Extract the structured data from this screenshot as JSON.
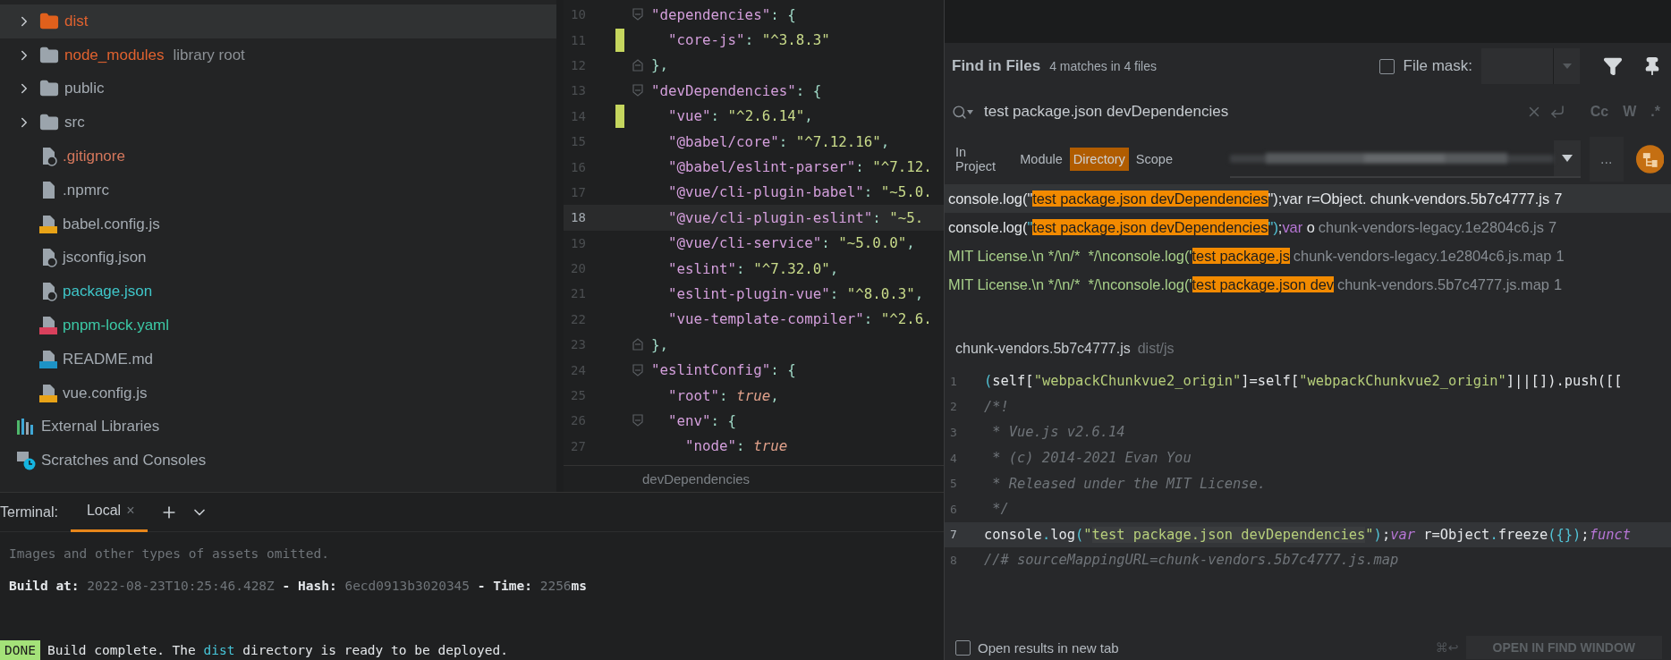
{
  "project_tree": {
    "items": [
      {
        "kind": "folder-excluded",
        "name": "dist",
        "color": "#e0622f",
        "expanded": false,
        "selected": true
      },
      {
        "kind": "folder",
        "name": "node_modules",
        "note": "library root",
        "color": "#e0622f",
        "expanded": false,
        "selected": false
      },
      {
        "kind": "folder",
        "name": "public",
        "color": "#a4abb2",
        "expanded": false,
        "selected": false
      },
      {
        "kind": "folder",
        "name": "src",
        "color": "#a4abb2",
        "expanded": false,
        "selected": false
      },
      {
        "kind": "ignore",
        "name": ".gitignore",
        "color": "#d4775c",
        "selected": false
      },
      {
        "kind": "text",
        "name": ".npmrc",
        "color": "#a4abb2",
        "selected": false
      },
      {
        "kind": "js",
        "name": "babel.config.js",
        "color": "#a4abb2",
        "selected": false
      },
      {
        "kind": "json",
        "name": "jsconfig.json",
        "color": "#a4abb2",
        "selected": false
      },
      {
        "kind": "json",
        "name": "package.json",
        "color": "#3fc6c9",
        "selected": false
      },
      {
        "kind": "yaml",
        "name": "pnpm-lock.yaml",
        "color": "#3cc9a6",
        "selected": false
      },
      {
        "kind": "md",
        "name": "README.md",
        "color": "#a4abb2",
        "selected": false
      },
      {
        "kind": "js",
        "name": "vue.config.js",
        "color": "#a4abb2",
        "selected": false
      },
      {
        "kind": "libraries",
        "name": "External Libraries",
        "color": "#a4abb2",
        "selected": false
      },
      {
        "kind": "scratches",
        "name": "Scratches and Consoles",
        "color": "#a4abb2",
        "selected": false
      }
    ]
  },
  "editor": {
    "lines": [
      {
        "number": "10",
        "kind": "fold-start",
        "changed": false,
        "current": false,
        "tokens": [
          {
            "kind": "key",
            "text": "\"dependencies\""
          },
          {
            "kind": "punct",
            "text": ": {"
          }
        ]
      },
      {
        "number": "11",
        "changed": true,
        "current": false,
        "tokens": [
          {
            "kind": "key",
            "text": "  \"core-js\""
          },
          {
            "kind": "punct",
            "text": ": "
          },
          {
            "kind": "str",
            "text": "\"^3.8.3\""
          }
        ]
      },
      {
        "number": "12",
        "kind": "fold-end",
        "changed": false,
        "current": false,
        "tokens": [
          {
            "kind": "punct",
            "text": "},"
          }
        ]
      },
      {
        "number": "13",
        "kind": "fold-start",
        "changed": false,
        "current": false,
        "tokens": [
          {
            "kind": "key",
            "text": "\"devDependencies\""
          },
          {
            "kind": "punct",
            "text": ": {"
          }
        ]
      },
      {
        "number": "14",
        "changed": true,
        "current": false,
        "tokens": [
          {
            "kind": "key",
            "text": "  \"vue\""
          },
          {
            "kind": "punct",
            "text": ": "
          },
          {
            "kind": "str",
            "text": "\"^2.6.14\""
          },
          {
            "kind": "punct",
            "text": ","
          }
        ]
      },
      {
        "number": "15",
        "changed": false,
        "current": false,
        "tokens": [
          {
            "kind": "key",
            "text": "  \"@babel/core\""
          },
          {
            "kind": "punct",
            "text": ": "
          },
          {
            "kind": "str",
            "text": "\"^7.12.16\""
          },
          {
            "kind": "punct",
            "text": ","
          }
        ]
      },
      {
        "number": "16",
        "changed": false,
        "current": false,
        "tokens": [
          {
            "kind": "key",
            "text": "  \"@babel/eslint-parser\""
          },
          {
            "kind": "punct",
            "text": ": "
          },
          {
            "kind": "str",
            "text": "\"^7.12."
          }
        ]
      },
      {
        "number": "17",
        "changed": false,
        "current": false,
        "tokens": [
          {
            "kind": "key",
            "text": "  \"@vue/cli-plugin-babel\""
          },
          {
            "kind": "punct",
            "text": ": "
          },
          {
            "kind": "str",
            "text": "\"~5.0."
          }
        ]
      },
      {
        "number": "18",
        "changed": false,
        "current": true,
        "tokens": [
          {
            "kind": "key",
            "text": "  \"@vue/cli-plugin-eslint\""
          },
          {
            "kind": "punct",
            "text": ": "
          },
          {
            "kind": "str",
            "text": "\"~5."
          }
        ]
      },
      {
        "number": "19",
        "changed": false,
        "current": false,
        "tokens": [
          {
            "kind": "key",
            "text": "  \"@vue/cli-service\""
          },
          {
            "kind": "punct",
            "text": ": "
          },
          {
            "kind": "str",
            "text": "\"~5.0.0\""
          },
          {
            "kind": "punct",
            "text": ","
          }
        ]
      },
      {
        "number": "20",
        "changed": false,
        "current": false,
        "tokens": [
          {
            "kind": "key",
            "text": "  \"eslint\""
          },
          {
            "kind": "punct",
            "text": ": "
          },
          {
            "kind": "str",
            "text": "\"^7.32.0\""
          },
          {
            "kind": "punct",
            "text": ","
          }
        ]
      },
      {
        "number": "21",
        "changed": false,
        "current": false,
        "tokens": [
          {
            "kind": "key",
            "text": "  \"eslint-plugin-vue\""
          },
          {
            "kind": "punct",
            "text": ": "
          },
          {
            "kind": "str",
            "text": "\"^8.0.3\""
          },
          {
            "kind": "punct",
            "text": ","
          }
        ]
      },
      {
        "number": "22",
        "changed": false,
        "current": false,
        "tokens": [
          {
            "kind": "key",
            "text": "  \"vue-template-compiler\""
          },
          {
            "kind": "punct",
            "text": ": "
          },
          {
            "kind": "str",
            "text": "\"^2.6."
          }
        ]
      },
      {
        "number": "23",
        "kind": "fold-end",
        "changed": false,
        "current": false,
        "tokens": [
          {
            "kind": "punct",
            "text": "},"
          }
        ]
      },
      {
        "number": "24",
        "kind": "fold-start",
        "changed": false,
        "current": false,
        "tokens": [
          {
            "kind": "key",
            "text": "\"eslintConfig\""
          },
          {
            "kind": "punct",
            "text": ": {"
          }
        ]
      },
      {
        "number": "25",
        "changed": false,
        "current": false,
        "tokens": [
          {
            "kind": "key",
            "text": "  \"root\""
          },
          {
            "kind": "punct",
            "text": ": "
          },
          {
            "kind": "bool",
            "text": "true"
          },
          {
            "kind": "punct",
            "text": ","
          }
        ]
      },
      {
        "number": "26",
        "kind": "fold-start",
        "changed": false,
        "current": false,
        "tokens": [
          {
            "kind": "key",
            "text": "  \"env\""
          },
          {
            "kind": "punct",
            "text": ": {"
          }
        ]
      },
      {
        "number": "27",
        "changed": false,
        "current": false,
        "tokens": [
          {
            "kind": "key",
            "text": "    \"node\""
          },
          {
            "kind": "punct",
            "text": ": "
          },
          {
            "kind": "bool",
            "text": "true"
          }
        ]
      }
    ],
    "breadcrumb": "devDependencies"
  },
  "terminal": {
    "label": "Terminal:",
    "tabs": [
      {
        "label": "Local",
        "close": "×",
        "selected": true
      }
    ],
    "lines": [
      {
        "tokens": [
          {
            "kind": "dim",
            "text": "Images and other types of assets omitted."
          }
        ]
      },
      {
        "tokens": [
          {
            "kind": "bold",
            "text": "Build at: "
          },
          {
            "kind": "dim",
            "text": "2022-08-23T10:25:46.428Z"
          },
          {
            "kind": "bold",
            "text": " - Hash: "
          },
          {
            "kind": "dim",
            "text": "6ecd0913b3020345"
          },
          {
            "kind": "bold",
            "text": " - Time: "
          },
          {
            "kind": "dim",
            "text": "2256"
          },
          {
            "kind": "bold",
            "text": "ms"
          }
        ]
      },
      {
        "badge": "DONE",
        "tokens": [
          {
            "kind": "plain",
            "text": "Build complete. The "
          },
          {
            "kind": "link",
            "text": "dist"
          },
          {
            "kind": "plain",
            "text": " directory is ready to be deployed."
          }
        ]
      }
    ]
  },
  "find_panel": {
    "title": "Find in Files",
    "summary": "4 matches in 4 files",
    "file_mask": {
      "label": "File mask:",
      "checked": false
    },
    "search": {
      "value": "test package.json devDependencies"
    },
    "options": [
      {
        "label": "Cc",
        "selected": false
      },
      {
        "label": "W",
        "selected": false
      },
      {
        "label": ".*",
        "selected": false
      }
    ],
    "scopes": [
      {
        "label": "In Project",
        "selected": false
      },
      {
        "label": "Module",
        "selected": false
      },
      {
        "label": "Directory",
        "selected": true
      },
      {
        "label": "Scope",
        "selected": false
      }
    ],
    "more_button": "...",
    "results": [
      {
        "selected": true,
        "tokens": [
          {
            "kind": "plain",
            "text": "console.log(\""
          },
          {
            "kind": "match",
            "text": "test package.json devDependencies"
          },
          {
            "kind": "plain",
            "text": "\");var r=Object."
          }
        ],
        "file": "chunk-vendors.5b7c4777.js",
        "line": "7"
      },
      {
        "selected": false,
        "tokens": [
          {
            "kind": "plain",
            "text": "console.log("
          },
          {
            "kind": "punct",
            "text": "\""
          },
          {
            "kind": "match",
            "text": "test package.json devDependencies"
          },
          {
            "kind": "punct",
            "text": "\")"
          },
          {
            "kind": "plain",
            "text": ";"
          },
          {
            "kind": "keyword",
            "text": "var"
          },
          {
            "kind": "plain",
            "text": " o"
          }
        ],
        "file": "chunk-vendors-legacy.1e2804c6.js",
        "line": "7"
      },
      {
        "selected": false,
        "tokens": [
          {
            "kind": "green",
            "text": "MIT License.\\n */\\n/*  */\\nconsole.log('"
          },
          {
            "kind": "match",
            "text": "test package.js"
          }
        ],
        "file": "chunk-vendors-legacy.1e2804c6.js.map",
        "line": "1"
      },
      {
        "selected": false,
        "tokens": [
          {
            "kind": "green",
            "text": "MIT License.\\n */\\n/*  */\\nconsole.log('"
          },
          {
            "kind": "match",
            "text": "test package.json dev"
          }
        ],
        "file": "chunk-vendors.5b7c4777.js.map",
        "line": "1"
      }
    ],
    "preview": {
      "file": "chunk-vendors.5b7c4777.js",
      "path": "dist/js",
      "lines": [
        {
          "number": "1",
          "current": false,
          "tokens": [
            {
              "kind": "punct",
              "text": "("
            },
            {
              "kind": "plain",
              "text": "self["
            },
            {
              "kind": "str",
              "text": "\"webpackChunkvue2_origin\""
            },
            {
              "kind": "plain",
              "text": "]=self["
            },
            {
              "kind": "str",
              "text": "\"webpackChunkvue2_origin\""
            },
            {
              "kind": "plain",
              "text": "]||[]).push([["
            }
          ]
        },
        {
          "number": "2",
          "current": false,
          "tokens": [
            {
              "kind": "comment",
              "text": "/*!"
            }
          ]
        },
        {
          "number": "3",
          "current": false,
          "tokens": [
            {
              "kind": "comment",
              "text": " * Vue.js v2.6.14"
            }
          ]
        },
        {
          "number": "4",
          "current": false,
          "tokens": [
            {
              "kind": "comment",
              "text": " * (c) 2014-2021 Evan You"
            }
          ]
        },
        {
          "number": "5",
          "current": false,
          "tokens": [
            {
              "kind": "comment",
              "text": " * Released under the MIT License."
            }
          ]
        },
        {
          "number": "6",
          "current": false,
          "tokens": [
            {
              "kind": "comment",
              "text": " */"
            }
          ]
        },
        {
          "number": "7",
          "current": true,
          "tokens": [
            {
              "kind": "plain",
              "text": "console"
            },
            {
              "kind": "punct",
              "text": "."
            },
            {
              "kind": "plain",
              "text": "log"
            },
            {
              "kind": "punct",
              "text": "("
            },
            {
              "kind": "str",
              "text": "\""
            },
            {
              "kind": "match",
              "text": "test package.json devDependencies"
            },
            {
              "kind": "str",
              "text": "\""
            },
            {
              "kind": "punct",
              "text": ")"
            },
            {
              "kind": "plain",
              "text": ";"
            },
            {
              "kind": "keyword",
              "text": "var"
            },
            {
              "kind": "plain",
              "text": " r=Object"
            },
            {
              "kind": "punct",
              "text": "."
            },
            {
              "kind": "plain",
              "text": "freeze"
            },
            {
              "kind": "punct",
              "text": "({})"
            },
            {
              "kind": "plain",
              "text": ";"
            },
            {
              "kind": "keyword",
              "text": "funct"
            }
          ]
        },
        {
          "number": "8",
          "current": false,
          "tokens": [
            {
              "kind": "comment",
              "text": "//# sourceMappingURL=chunk-vendors.5b7c4777.js.map"
            }
          ]
        }
      ]
    },
    "footer": {
      "new_tab": {
        "label": "Open results in new tab",
        "checked": false
      },
      "shortcut": "⌘↩",
      "open_button": "OPEN IN FIND WINDOW"
    }
  }
}
